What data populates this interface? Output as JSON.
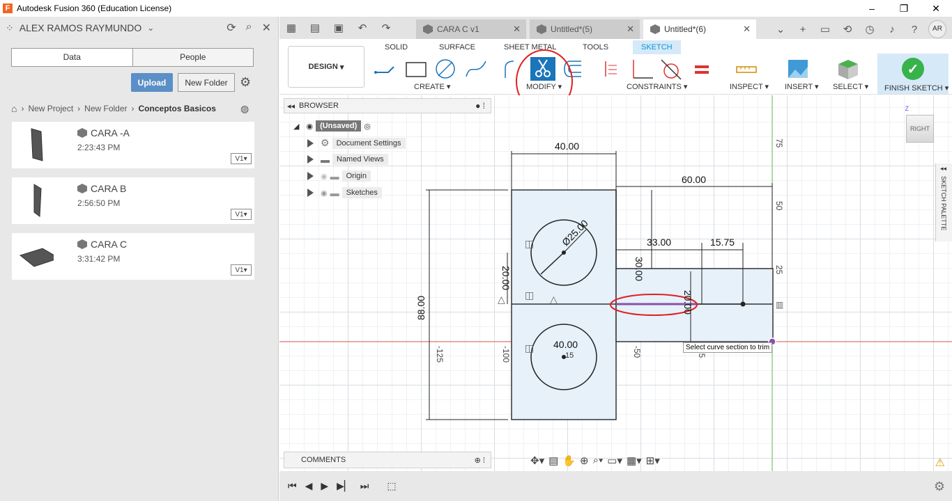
{
  "window": {
    "title": "Autodesk Fusion 360 (Education License)",
    "app_icon": "F",
    "minimize": "–",
    "maximize": "❐",
    "close": "✕"
  },
  "data_panel": {
    "user": "ALEX RAMOS RAYMUNDO",
    "tabs": [
      "Data",
      "People"
    ],
    "upload_label": "Upload",
    "new_folder_label": "New Folder",
    "breadcrumb": [
      "New Project",
      "New Folder",
      "Conceptos Basicos"
    ],
    "files": [
      {
        "name": "CARA -A",
        "time": "2:23:43 PM",
        "version": "V1"
      },
      {
        "name": "CARA B",
        "time": "2:56:50 PM",
        "version": "V1"
      },
      {
        "name": "CARA C",
        "time": "3:31:42 PM",
        "version": "V1"
      }
    ]
  },
  "doc_tabs": [
    {
      "label": "CARA C v1",
      "active": false
    },
    {
      "label": "Untitled*(5)",
      "active": false
    },
    {
      "label": "Untitled*(6)",
      "active": true
    }
  ],
  "user_initials": "AR",
  "ribbon": {
    "design_label": "DESIGN",
    "tabs": [
      "SOLID",
      "SURFACE",
      "SHEET METAL",
      "TOOLS",
      "SKETCH"
    ],
    "active_tab": "SKETCH",
    "groups": [
      "CREATE",
      "MODIFY",
      "CONSTRAINTS",
      "INSPECT",
      "INSERT",
      "SELECT"
    ],
    "finish_label": "FINISH SKETCH"
  },
  "browser": {
    "title": "BROWSER",
    "root": "(Unsaved)",
    "items": [
      "Document Settings",
      "Named Views",
      "Origin",
      "Sketches"
    ]
  },
  "comments_label": "COMMENTS",
  "sketch_palette_label": "SKETCH PALETTE",
  "viewcube_label": "RIGHT",
  "viewcube_axis": "Z",
  "tooltip": "Select curve section to trim",
  "dimensions": {
    "d40_top": "40.00",
    "d60": "60.00",
    "d33": "33.00",
    "d15_75": "15.75",
    "d30": "30.00",
    "d25": "Ø25.00",
    "d20": "20.00",
    "d88": "88.00",
    "d40_bottom": "40.00",
    "d20_right": "20.00",
    "d15_small": "15"
  },
  "axis_ticks": {
    "v75": "75",
    "v50": "50",
    "v25": "25",
    "hm125": "-125",
    "hm100": "-100",
    "hm50": "-50",
    "hm25": "-25"
  },
  "colors": {
    "accent": "#0696d7",
    "finish_green": "#36b34a",
    "annotation_red": "#e02020",
    "profile_fill": "#e6f1fa",
    "trim_highlight": "#8e4fa8",
    "x_axis": "#e25757",
    "z_axis": "#5cc35c"
  }
}
